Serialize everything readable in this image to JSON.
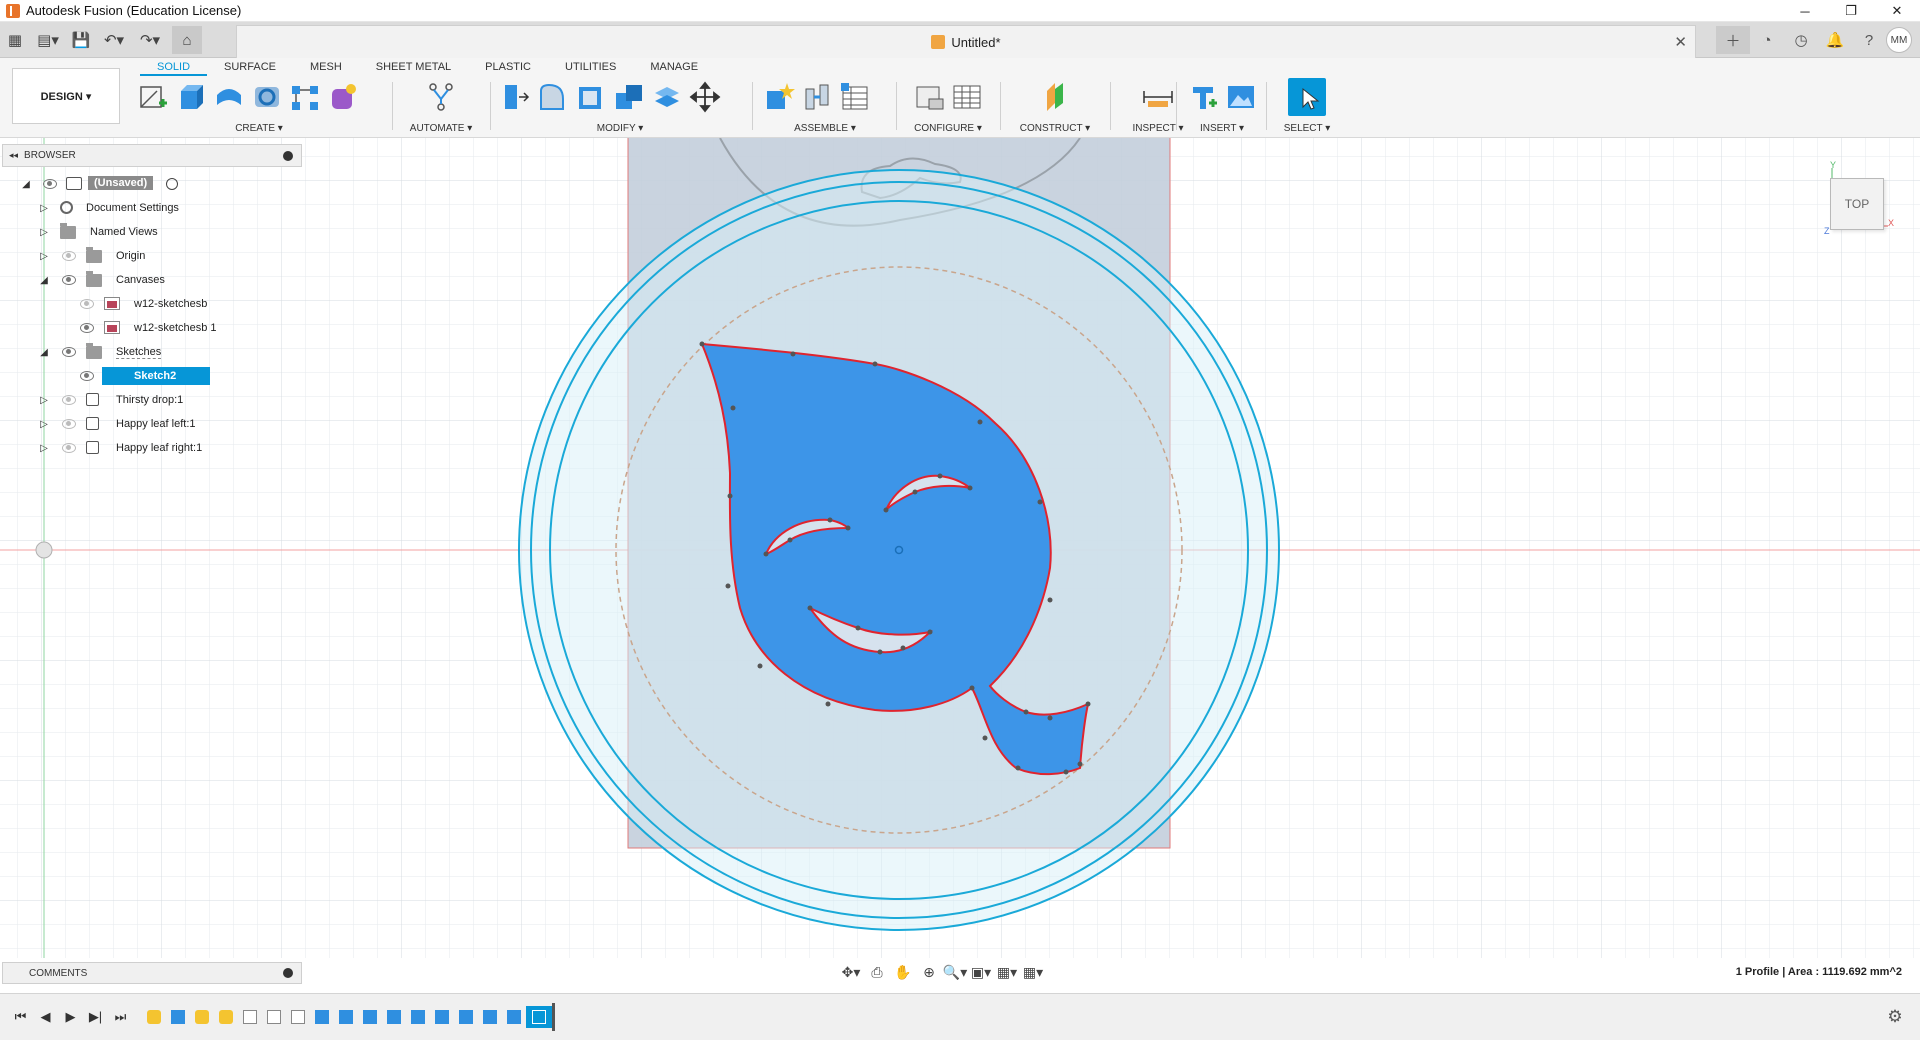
{
  "window": {
    "title": "Autodesk Fusion (Education License)",
    "minimize": "─",
    "restore": "❐",
    "close": "✕"
  },
  "document": {
    "tab_name": "Untitled*",
    "close": "✕"
  },
  "quick_access": [
    "▦",
    "▤▾",
    "💾",
    "↶▾",
    "↷▾",
    "⌂"
  ],
  "top_right": [
    "＋",
    "◔",
    "◷",
    "🔔",
    "?"
  ],
  "user": {
    "initials": "MM"
  },
  "workspace": {
    "label": "DESIGN ▾"
  },
  "ribbon_tabs": [
    "SOLID",
    "SURFACE",
    "MESH",
    "SHEET METAL",
    "PLASTIC",
    "UTILITIES",
    "MANAGE"
  ],
  "active_tab": "SOLID",
  "groups": {
    "create": "CREATE ▾",
    "automate": "AUTOMATE ▾",
    "modify": "MODIFY ▾",
    "assemble": "ASSEMBLE ▾",
    "configure": "CONFIGURE ▾",
    "construct": "CONSTRUCT ▾",
    "inspect": "INSPECT ▾",
    "insert": "INSERT ▾",
    "select": "SELECT ▾"
  },
  "browser": {
    "title": "BROWSER",
    "collapse": "◂◂",
    "root": "(Unsaved)",
    "items": {
      "document_settings": "Document Settings",
      "named_views": "Named Views",
      "origin": "Origin",
      "canvases": "Canvases",
      "canvas1": "w12-sketchesb",
      "canvas2": "w12-sketchesb 1",
      "sketches": "Sketches",
      "sketch2": "Sketch2",
      "thirsty": "Thirsty drop:1",
      "happy_left": "Happy leaf left:1",
      "happy_right": "Happy leaf right:1"
    }
  },
  "viewcube": {
    "face": "TOP",
    "axis_x": "X",
    "axis_y": "Y",
    "axis_z": "Z"
  },
  "comments": {
    "title": "COMMENTS"
  },
  "navbar": [
    "✥▾",
    "⎙",
    "✋",
    "⊕",
    "🔍▾",
    "▣▾",
    "▦▾",
    "▦▾"
  ],
  "status": {
    "text": "1 Profile | Area : 1119.692 mm^2"
  },
  "timeline": {
    "controls": [
      "⏮",
      "◀",
      "▶",
      "▶|",
      "⏭"
    ],
    "settings": "⚙"
  },
  "colors": {
    "accent": "#0696d7",
    "profile_fill": "#3d95e8",
    "profile_edge": "#e0242e",
    "circle": "#1aa9d8",
    "grid": "#e4e8ec"
  }
}
